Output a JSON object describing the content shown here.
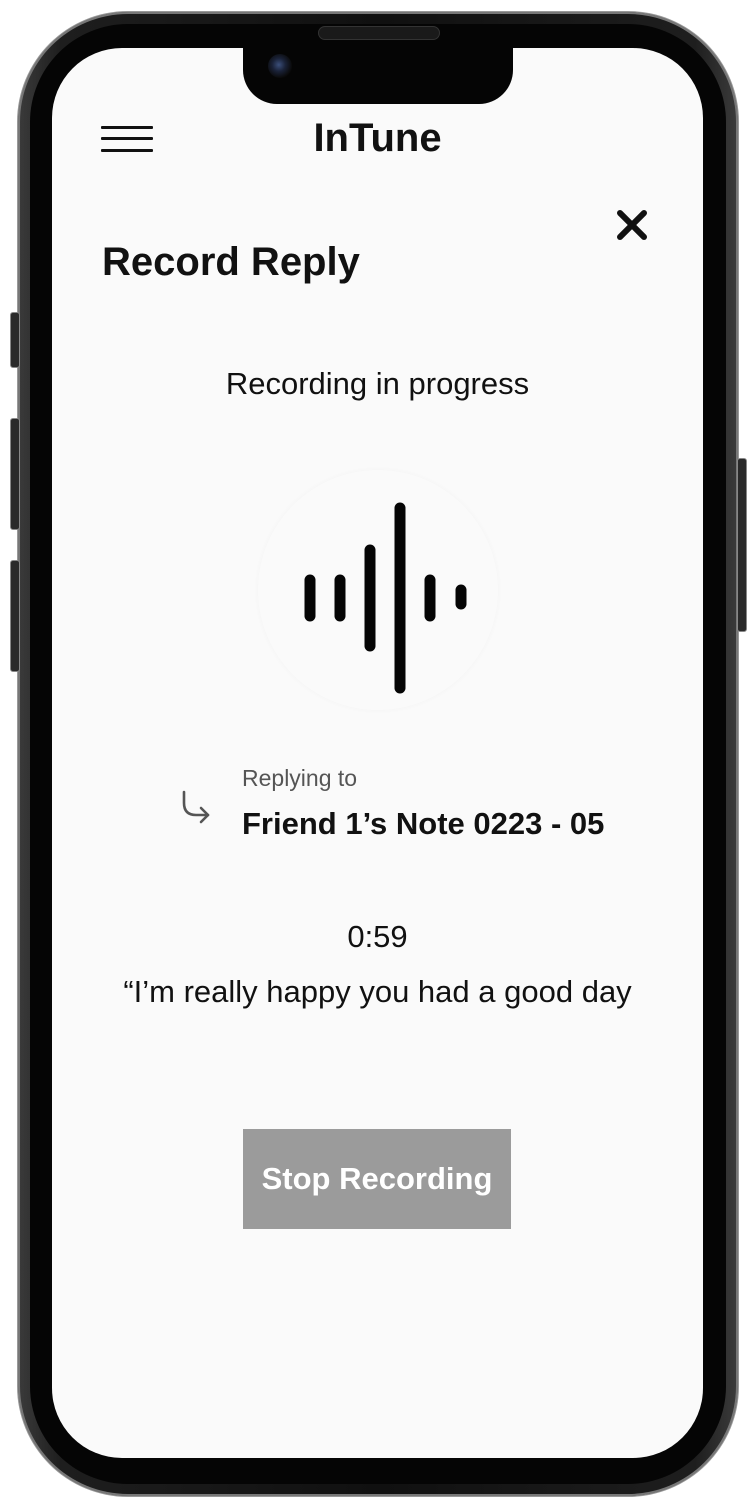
{
  "app": {
    "title": "InTune"
  },
  "header": {
    "menu_icon": "hamburger-menu-icon",
    "close_icon": "close-icon"
  },
  "page": {
    "title": "Record Reply",
    "status": "Recording in progress",
    "waveform_icon": "audio-waveform-icon"
  },
  "reply": {
    "icon": "reply-arrow-icon",
    "label": "Replying to",
    "target": "Friend 1’s Note 0223 - 05"
  },
  "recording": {
    "timer": "0:59",
    "transcript": "“I’m really happy you had a good day"
  },
  "actions": {
    "stop_label": "Stop Recording"
  },
  "colors": {
    "background": "#fafafa",
    "text": "#111111",
    "muted_text": "#555555",
    "button_bg": "#9b9b9b",
    "button_text": "#ffffff"
  }
}
